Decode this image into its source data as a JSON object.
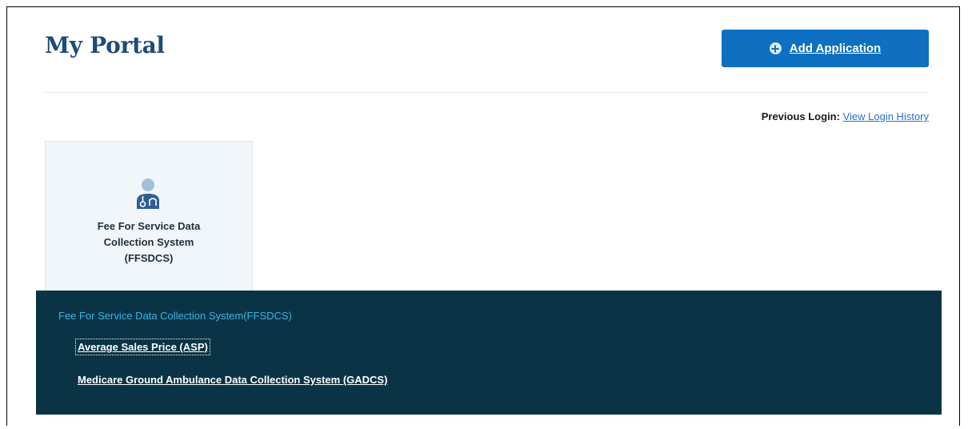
{
  "header": {
    "title": "My Portal",
    "add_button_label": "Add Application",
    "add_button_icon": "plus-circle-icon"
  },
  "login": {
    "label": "Previous Login:",
    "link_text": "View Login History"
  },
  "app_card": {
    "icon": "doctor-icon",
    "name_lines": [
      "Fee For Service Data",
      "Collection System",
      "(FFSDCS)"
    ]
  },
  "dropdown": {
    "title": "Fee For Service Data Collection System(FFSDCS)",
    "links": [
      "Average Sales Price (ASP)",
      "Medicare Ground Ambulance Data Collection System (GADCS)"
    ]
  },
  "colors": {
    "title": "#1d4b7a",
    "primary_button": "#0f6fc0",
    "card_background": "#f1f6fa",
    "panel_background": "#0a3446",
    "panel_title": "#3cb4e0",
    "link": "#2a6fc6"
  }
}
